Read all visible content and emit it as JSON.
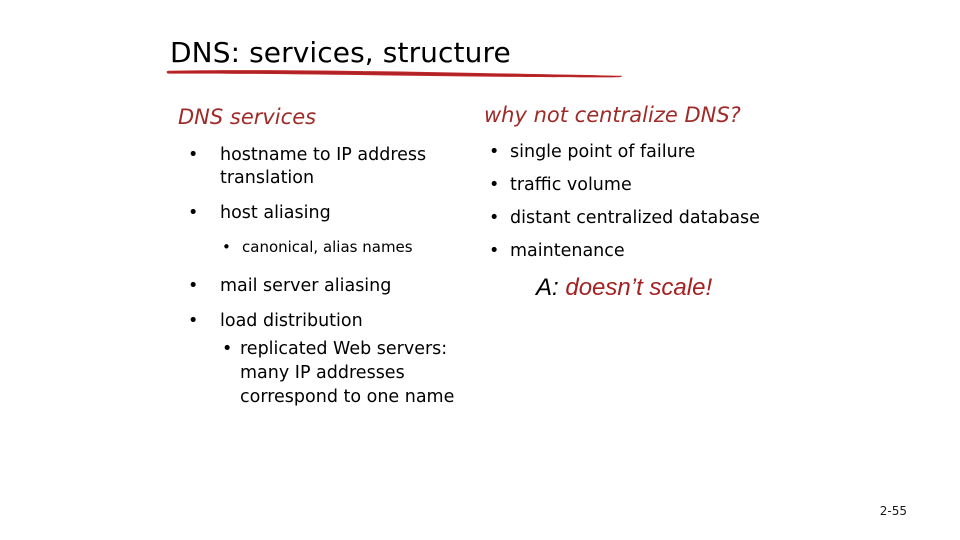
{
  "slide": {
    "title": "DNS: services, structure",
    "page_number": "2-55",
    "accent_red": "#9E2B28",
    "answer_red": "#A52121",
    "underline_color": "#C0282A",
    "background": "#ffffff"
  },
  "left_column": {
    "heading": "DNS services",
    "bullets": [
      {
        "level": 1,
        "text": "hostname to IP address translation"
      },
      {
        "level": 1,
        "text": "host aliasing"
      },
      {
        "level": 2,
        "text": "canonical, alias names"
      },
      {
        "level": 1,
        "text": "mail server aliasing"
      },
      {
        "level": 1,
        "text": "load distribution"
      },
      {
        "level": 2,
        "text": "replicated Web servers: many IP addresses correspond to one name"
      }
    ],
    "bullet_glyph": "•"
  },
  "right_column": {
    "heading": "why not centralize DNS?",
    "bullets": [
      {
        "level": 1,
        "text": "single point of failure"
      },
      {
        "level": 1,
        "text": "traffic volume"
      },
      {
        "level": 1,
        "text": "distant centralized database"
      },
      {
        "level": 1,
        "text": "maintenance"
      }
    ],
    "bullet_glyph": "•",
    "answer_prefix": "A:",
    "answer_text": "doesn’t scale!"
  }
}
